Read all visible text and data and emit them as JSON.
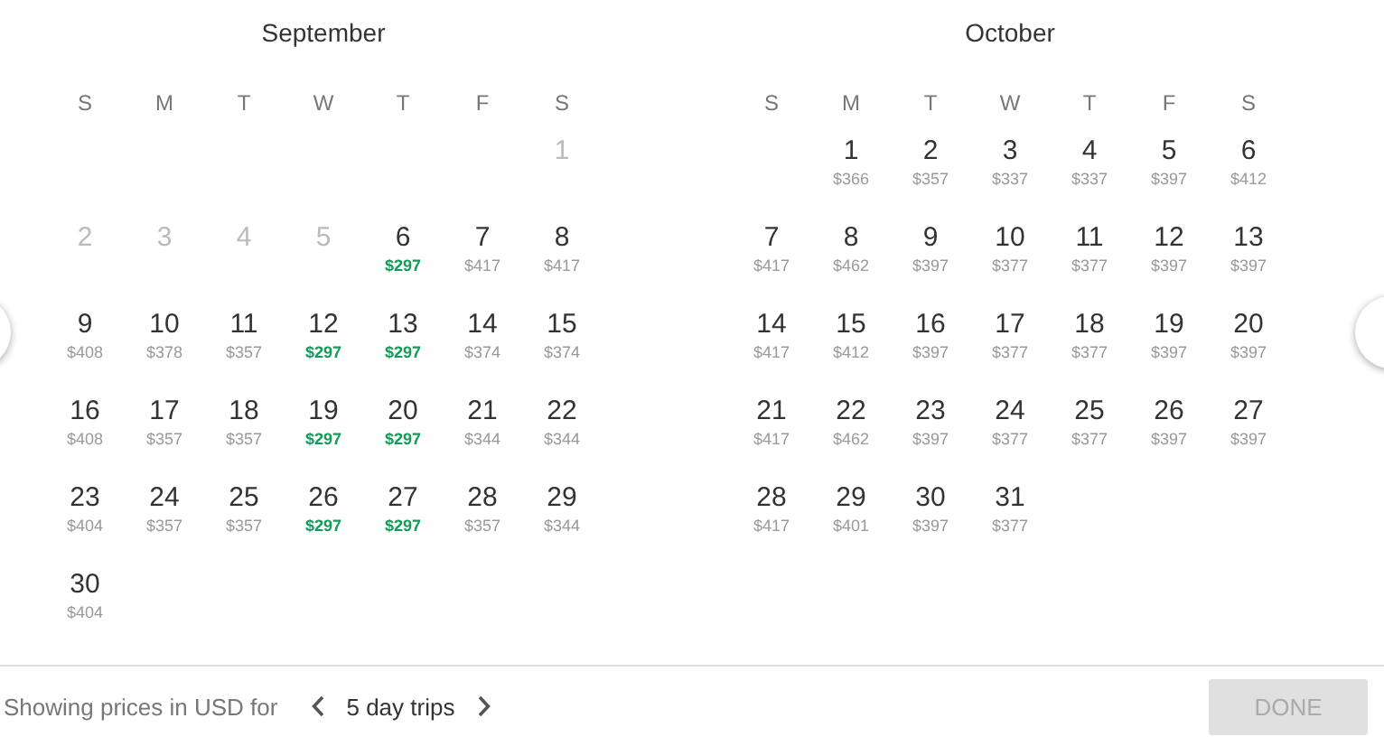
{
  "months": [
    {
      "title": "September",
      "weekdays": [
        "S",
        "M",
        "T",
        "W",
        "T",
        "F",
        "S"
      ],
      "weeks": [
        [
          {
            "kind": "blank"
          },
          {
            "kind": "blank"
          },
          {
            "kind": "blank"
          },
          {
            "kind": "blank"
          },
          {
            "kind": "blank"
          },
          {
            "kind": "blank"
          },
          {
            "kind": "day",
            "day": "1",
            "disabled": true
          }
        ],
        [
          {
            "kind": "day",
            "day": "2",
            "disabled": true
          },
          {
            "kind": "day",
            "day": "3",
            "disabled": true
          },
          {
            "kind": "day",
            "day": "4",
            "disabled": true
          },
          {
            "kind": "day",
            "day": "5",
            "disabled": true
          },
          {
            "kind": "day",
            "day": "6",
            "price": "$297",
            "disabled": false,
            "lowest": true
          },
          {
            "kind": "day",
            "day": "7",
            "price": "$417",
            "disabled": false,
            "lowest": false
          },
          {
            "kind": "day",
            "day": "8",
            "price": "$417",
            "disabled": false,
            "lowest": false
          }
        ],
        [
          {
            "kind": "day",
            "day": "9",
            "price": "$408",
            "disabled": false,
            "lowest": false
          },
          {
            "kind": "day",
            "day": "10",
            "price": "$378",
            "disabled": false,
            "lowest": false
          },
          {
            "kind": "day",
            "day": "11",
            "price": "$357",
            "disabled": false,
            "lowest": false
          },
          {
            "kind": "day",
            "day": "12",
            "price": "$297",
            "disabled": false,
            "lowest": true
          },
          {
            "kind": "day",
            "day": "13",
            "price": "$297",
            "disabled": false,
            "lowest": true
          },
          {
            "kind": "day",
            "day": "14",
            "price": "$374",
            "disabled": false,
            "lowest": false
          },
          {
            "kind": "day",
            "day": "15",
            "price": "$374",
            "disabled": false,
            "lowest": false
          }
        ],
        [
          {
            "kind": "day",
            "day": "16",
            "price": "$408",
            "disabled": false,
            "lowest": false
          },
          {
            "kind": "day",
            "day": "17",
            "price": "$357",
            "disabled": false,
            "lowest": false
          },
          {
            "kind": "day",
            "day": "18",
            "price": "$357",
            "disabled": false,
            "lowest": false
          },
          {
            "kind": "day",
            "day": "19",
            "price": "$297",
            "disabled": false,
            "lowest": true
          },
          {
            "kind": "day",
            "day": "20",
            "price": "$297",
            "disabled": false,
            "lowest": true
          },
          {
            "kind": "day",
            "day": "21",
            "price": "$344",
            "disabled": false,
            "lowest": false
          },
          {
            "kind": "day",
            "day": "22",
            "price": "$344",
            "disabled": false,
            "lowest": false
          }
        ],
        [
          {
            "kind": "day",
            "day": "23",
            "price": "$404",
            "disabled": false,
            "lowest": false
          },
          {
            "kind": "day",
            "day": "24",
            "price": "$357",
            "disabled": false,
            "lowest": false
          },
          {
            "kind": "day",
            "day": "25",
            "price": "$357",
            "disabled": false,
            "lowest": false
          },
          {
            "kind": "day",
            "day": "26",
            "price": "$297",
            "disabled": false,
            "lowest": true
          },
          {
            "kind": "day",
            "day": "27",
            "price": "$297",
            "disabled": false,
            "lowest": true
          },
          {
            "kind": "day",
            "day": "28",
            "price": "$357",
            "disabled": false,
            "lowest": false
          },
          {
            "kind": "day",
            "day": "29",
            "price": "$344",
            "disabled": false,
            "lowest": false
          }
        ],
        [
          {
            "kind": "day",
            "day": "30",
            "price": "$404",
            "disabled": false,
            "lowest": false
          },
          {
            "kind": "blank"
          },
          {
            "kind": "blank"
          },
          {
            "kind": "blank"
          },
          {
            "kind": "blank"
          },
          {
            "kind": "blank"
          },
          {
            "kind": "blank"
          }
        ]
      ]
    },
    {
      "title": "October",
      "weekdays": [
        "S",
        "M",
        "T",
        "W",
        "T",
        "F",
        "S"
      ],
      "weeks": [
        [
          {
            "kind": "blank"
          },
          {
            "kind": "day",
            "day": "1",
            "price": "$366",
            "disabled": false,
            "lowest": false
          },
          {
            "kind": "day",
            "day": "2",
            "price": "$357",
            "disabled": false,
            "lowest": false
          },
          {
            "kind": "day",
            "day": "3",
            "price": "$337",
            "disabled": false,
            "lowest": false
          },
          {
            "kind": "day",
            "day": "4",
            "price": "$337",
            "disabled": false,
            "lowest": false
          },
          {
            "kind": "day",
            "day": "5",
            "price": "$397",
            "disabled": false,
            "lowest": false
          },
          {
            "kind": "day",
            "day": "6",
            "price": "$412",
            "disabled": false,
            "lowest": false
          }
        ],
        [
          {
            "kind": "day",
            "day": "7",
            "price": "$417",
            "disabled": false,
            "lowest": false
          },
          {
            "kind": "day",
            "day": "8",
            "price": "$462",
            "disabled": false,
            "lowest": false
          },
          {
            "kind": "day",
            "day": "9",
            "price": "$397",
            "disabled": false,
            "lowest": false
          },
          {
            "kind": "day",
            "day": "10",
            "price": "$377",
            "disabled": false,
            "lowest": false
          },
          {
            "kind": "day",
            "day": "11",
            "price": "$377",
            "disabled": false,
            "lowest": false
          },
          {
            "kind": "day",
            "day": "12",
            "price": "$397",
            "disabled": false,
            "lowest": false
          },
          {
            "kind": "day",
            "day": "13",
            "price": "$397",
            "disabled": false,
            "lowest": false
          }
        ],
        [
          {
            "kind": "day",
            "day": "14",
            "price": "$417",
            "disabled": false,
            "lowest": false
          },
          {
            "kind": "day",
            "day": "15",
            "price": "$412",
            "disabled": false,
            "lowest": false
          },
          {
            "kind": "day",
            "day": "16",
            "price": "$397",
            "disabled": false,
            "lowest": false
          },
          {
            "kind": "day",
            "day": "17",
            "price": "$377",
            "disabled": false,
            "lowest": false
          },
          {
            "kind": "day",
            "day": "18",
            "price": "$377",
            "disabled": false,
            "lowest": false
          },
          {
            "kind": "day",
            "day": "19",
            "price": "$397",
            "disabled": false,
            "lowest": false
          },
          {
            "kind": "day",
            "day": "20",
            "price": "$397",
            "disabled": false,
            "lowest": false
          }
        ],
        [
          {
            "kind": "day",
            "day": "21",
            "price": "$417",
            "disabled": false,
            "lowest": false
          },
          {
            "kind": "day",
            "day": "22",
            "price": "$462",
            "disabled": false,
            "lowest": false
          },
          {
            "kind": "day",
            "day": "23",
            "price": "$397",
            "disabled": false,
            "lowest": false
          },
          {
            "kind": "day",
            "day": "24",
            "price": "$377",
            "disabled": false,
            "lowest": false
          },
          {
            "kind": "day",
            "day": "25",
            "price": "$377",
            "disabled": false,
            "lowest": false
          },
          {
            "kind": "day",
            "day": "26",
            "price": "$397",
            "disabled": false,
            "lowest": false
          },
          {
            "kind": "day",
            "day": "27",
            "price": "$397",
            "disabled": false,
            "lowest": false
          }
        ],
        [
          {
            "kind": "day",
            "day": "28",
            "price": "$417",
            "disabled": false,
            "lowest": false
          },
          {
            "kind": "day",
            "day": "29",
            "price": "$401",
            "disabled": false,
            "lowest": false
          },
          {
            "kind": "day",
            "day": "30",
            "price": "$397",
            "disabled": false,
            "lowest": false
          },
          {
            "kind": "day",
            "day": "31",
            "price": "$377",
            "disabled": false,
            "lowest": false
          },
          {
            "kind": "blank"
          },
          {
            "kind": "blank"
          },
          {
            "kind": "blank"
          }
        ]
      ]
    }
  ],
  "footer": {
    "label": "Showing prices in USD for",
    "trip_length": "5 day trips",
    "done_button": {
      "label": "DONE",
      "disabled": true
    }
  }
}
